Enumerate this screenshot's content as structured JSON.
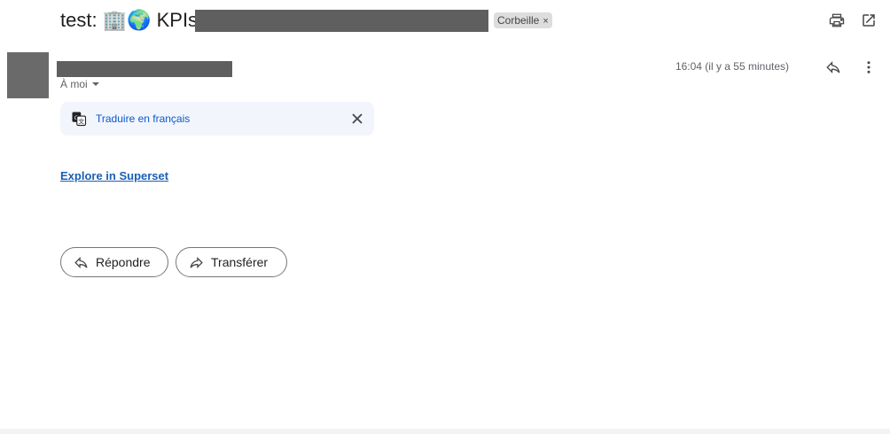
{
  "subject": {
    "prefix": "test: ",
    "emoji": "🏢🌍",
    "text": " KPIs"
  },
  "label_chip": {
    "label": "Corbeille",
    "remove": "×"
  },
  "header_icons": [
    "print-icon",
    "open-in-new-window-icon"
  ],
  "message": {
    "recipient": "À moi",
    "time": "16:04 (il y a 55 minutes)"
  },
  "translate_bar": {
    "link": "Traduire en français"
  },
  "body": {
    "link": "Explore in Superset"
  },
  "actions": {
    "reply": "Répondre",
    "forward": "Transférer"
  },
  "colors": {
    "accent": "#0b57d0",
    "link": "#1a5fb4",
    "redaction": "#5f5f5f"
  }
}
